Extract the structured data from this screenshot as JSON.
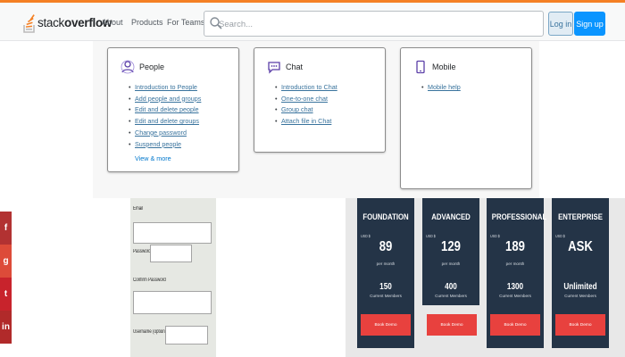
{
  "header": {
    "logo_text_light": "stack",
    "logo_text_bold": "overflow",
    "nav": [
      "About",
      "Products",
      "For Teams"
    ],
    "search_placeholder": "Search...",
    "login_label": "Log in",
    "signup_label": "Sign up",
    "accent_color": "#f48024",
    "primary_color": "#0a95ff"
  },
  "help_cards": [
    {
      "icon": "people-icon",
      "title": "People",
      "links": [
        "Introduction to People",
        "Add people and groups",
        "Edit and delete people",
        "Edit and delete groups",
        "Change password",
        "Suspend people"
      ],
      "view_more": "View & more"
    },
    {
      "icon": "chat-icon",
      "title": "Chat",
      "links": [
        "Introduction to Chat",
        "One-to-one chat",
        "Group chat",
        "Attach file in Chat"
      ]
    },
    {
      "icon": "mobile-icon",
      "title": "Mobile",
      "links": [
        "Mobile help"
      ]
    }
  ],
  "social": [
    {
      "icon": "facebook-icon",
      "glyph": "f",
      "color": "#b23232"
    },
    {
      "icon": "google-plus-icon",
      "glyph": "g",
      "color": "#dd4b39"
    },
    {
      "icon": "twitter-icon",
      "glyph": "t",
      "color": "#c8232c"
    },
    {
      "icon": "linkedin-icon",
      "glyph": "in",
      "color": "#b12a2a"
    }
  ],
  "form": {
    "email_label": "Email",
    "password_label": "Password",
    "confirm_label": "Confirm Password",
    "username_label": "Username (optional)"
  },
  "plans": [
    {
      "name": "FOUNDATION",
      "currency": "USD $",
      "price": "89",
      "per": "per month",
      "members": "150",
      "members_label": "Current Members",
      "button": "Book Demo"
    },
    {
      "name": "ADVANCED",
      "currency": "USD $",
      "price": "129",
      "per": "per month",
      "members": "400",
      "members_label": "Current Members",
      "button": "Book Demo"
    },
    {
      "name": "PROFESSIONAL",
      "currency": "USD $",
      "price": "189",
      "per": "per month",
      "members": "1300",
      "members_label": "Current Members",
      "button": "Book Demo"
    },
    {
      "name": "ENTERPRISE",
      "currency": "USD $",
      "price": "ASK",
      "per": "",
      "members": "Unlimited",
      "members_label": "Current Members",
      "button": "Book Demo"
    }
  ]
}
